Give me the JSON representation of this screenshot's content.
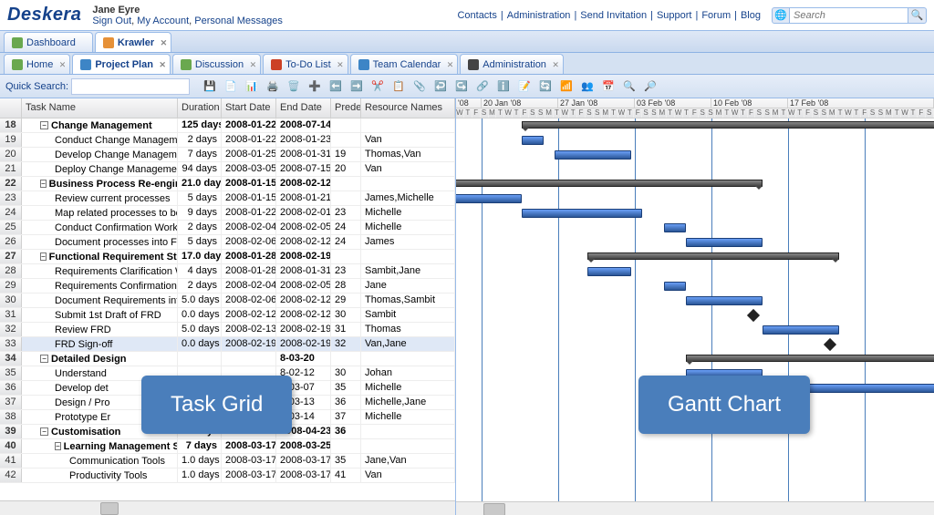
{
  "brand": "Deskera",
  "user": {
    "name": "Jane Eyre",
    "links": [
      "Sign Out",
      "My Account",
      "Personal Messages"
    ]
  },
  "header_links": [
    "Contacts",
    "Administration",
    "Send Invitation",
    "Support",
    "Forum",
    "Blog"
  ],
  "search": {
    "placeholder": "Search"
  },
  "main_tabs": [
    {
      "label": "Dashboard",
      "icon": "#6aa84f",
      "closable": false
    },
    {
      "label": "Krawler",
      "icon": "#e69138",
      "closable": true,
      "active": true
    }
  ],
  "sub_tabs": [
    {
      "label": "Home",
      "icon": "#6aa84f"
    },
    {
      "label": "Project Plan",
      "icon": "#3d85c6",
      "active": true
    },
    {
      "label": "Discussion",
      "icon": "#6aa84f"
    },
    {
      "label": "To-Do List",
      "icon": "#cc4125"
    },
    {
      "label": "Team Calendar",
      "icon": "#3d85c6"
    },
    {
      "label": "Administration",
      "icon": "#444"
    }
  ],
  "toolbar": {
    "quicksearch_label": "Quick Search:",
    "buttons": [
      "save",
      "export",
      "export2",
      "print",
      "delete",
      "add-task",
      "outdent",
      "indent",
      "cut",
      "copy",
      "paste",
      "undo",
      "redo",
      "link",
      "info",
      "note",
      "refresh",
      "sort-asc",
      "sort-desc",
      "today",
      "zoom-in",
      "zoom-out"
    ]
  },
  "grid_headers": {
    "name": "Task Name",
    "dur": "Duration",
    "sd": "Start Date",
    "ed": "End Date",
    "pred": "Predecessor",
    "res": "Resource Names"
  },
  "rows": [
    {
      "n": 18,
      "group": true,
      "ind": 1,
      "name": "Change Management",
      "dur": "125 days",
      "sd": "2008-01-22",
      "ed": "2008-07-14",
      "pred": "",
      "res": ""
    },
    {
      "n": 19,
      "group": false,
      "ind": 2,
      "name": "Conduct Change Management Pl",
      "dur": "2 days",
      "sd": "2008-01-22",
      "ed": "2008-01-23",
      "pred": "",
      "res": "Van"
    },
    {
      "n": 20,
      "group": false,
      "ind": 2,
      "name": "Develop Change Management Pl",
      "dur": "7 days",
      "sd": "2008-01-25",
      "ed": "2008-01-31",
      "pred": "19",
      "res": "Thomas,Van"
    },
    {
      "n": 21,
      "group": false,
      "ind": 2,
      "name": "Deploy Change Management Act",
      "dur": "94 days",
      "sd": "2008-03-05",
      "ed": "2008-07-15",
      "pred": "20",
      "res": "Van"
    },
    {
      "n": 22,
      "group": true,
      "ind": 1,
      "name": "Business Process Re-engineering",
      "dur": "21.0 days",
      "sd": "2008-01-15",
      "ed": "2008-02-12",
      "pred": "",
      "res": ""
    },
    {
      "n": 23,
      "group": false,
      "ind": 2,
      "name": "Review current processes",
      "dur": "5 days",
      "sd": "2008-01-15",
      "ed": "2008-01-21",
      "pred": "",
      "res": "James,Michelle"
    },
    {
      "n": 24,
      "group": false,
      "ind": 2,
      "name": "Map related processes to best p",
      "dur": "9 days",
      "sd": "2008-01-22",
      "ed": "2008-02-01",
      "pred": "23",
      "res": "Michelle"
    },
    {
      "n": 25,
      "group": false,
      "ind": 2,
      "name": "Conduct Confirmation Workshop",
      "dur": "2 days",
      "sd": "2008-02-04",
      "ed": "2008-02-05",
      "pred": "24",
      "res": "Michelle"
    },
    {
      "n": 26,
      "group": false,
      "ind": 2,
      "name": "Document processes into Functi",
      "dur": "5 days",
      "sd": "2008-02-06",
      "ed": "2008-02-12",
      "pred": "24",
      "res": "James"
    },
    {
      "n": 27,
      "group": true,
      "ind": 1,
      "name": "Functional Requirement Study",
      "dur": "17.0 days",
      "sd": "2008-01-28",
      "ed": "2008-02-19",
      "pred": "",
      "res": ""
    },
    {
      "n": 28,
      "group": false,
      "ind": 2,
      "name": "Requirements Clarification Works",
      "dur": "4 days",
      "sd": "2008-01-28",
      "ed": "2008-01-31",
      "pred": "23",
      "res": "Sambit,Jane"
    },
    {
      "n": 29,
      "group": false,
      "ind": 2,
      "name": "Requirements Confirmation work",
      "dur": "2 days",
      "sd": "2008-02-04",
      "ed": "2008-02-05",
      "pred": "28",
      "res": "Jane"
    },
    {
      "n": 30,
      "group": false,
      "ind": 2,
      "name": "Document Requirements into FRD",
      "dur": "5.0 days",
      "sd": "2008-02-06",
      "ed": "2008-02-12",
      "pred": "29",
      "res": "Thomas,Sambit"
    },
    {
      "n": 31,
      "group": false,
      "ind": 2,
      "name": "Submit 1st Draft of FRD",
      "dur": "0.0 days",
      "sd": "2008-02-12",
      "ed": "2008-02-12",
      "pred": "30",
      "res": "Sambit"
    },
    {
      "n": 32,
      "group": false,
      "ind": 2,
      "name": "Review FRD",
      "dur": "5.0 days",
      "sd": "2008-02-13",
      "ed": "2008-02-19",
      "pred": "31",
      "res": "Thomas"
    },
    {
      "n": 33,
      "group": false,
      "ind": 2,
      "name": "FRD Sign-off",
      "dur": "0.0 days",
      "sd": "2008-02-19",
      "ed": "2008-02-19",
      "pred": "32",
      "res": "Van,Jane",
      "sel": true
    },
    {
      "n": 34,
      "group": true,
      "ind": 1,
      "name": "Detailed Design",
      "dur": "",
      "sd": "",
      "ed": "8-03-20",
      "pred": "",
      "res": ""
    },
    {
      "n": 35,
      "group": false,
      "ind": 2,
      "name": "Understand",
      "dur": "",
      "sd": "",
      "ed": "8-02-12",
      "pred": "30",
      "res": "Johan"
    },
    {
      "n": 36,
      "group": false,
      "ind": 2,
      "name": "Develop det",
      "dur": "",
      "sd": "",
      "ed": "8-03-07",
      "pred": "35",
      "res": "Michelle"
    },
    {
      "n": 37,
      "group": false,
      "ind": 2,
      "name": "Design / Pro",
      "dur": "",
      "sd": "",
      "ed": "8-03-13",
      "pred": "36",
      "res": "Michelle,Jane"
    },
    {
      "n": 38,
      "group": false,
      "ind": 2,
      "name": "Prototype Er",
      "dur": "",
      "sd": "",
      "ed": "8-03-14",
      "pred": "37",
      "res": "Michelle"
    },
    {
      "n": 39,
      "group": true,
      "ind": 1,
      "name": "Customisation",
      "dur": "28 days",
      "sd": "2008-03-17",
      "ed": "2008-04-23",
      "pred": "36",
      "res": ""
    },
    {
      "n": 40,
      "group": true,
      "ind": 2,
      "name": "Learning Management System",
      "dur": "7 days",
      "sd": "2008-03-17",
      "ed": "2008-03-25",
      "pred": "",
      "res": ""
    },
    {
      "n": 41,
      "group": false,
      "ind": 3,
      "name": "Communication Tools",
      "dur": "1.0 days",
      "sd": "2008-03-17",
      "ed": "2008-03-17",
      "pred": "35",
      "res": "Jane,Van"
    },
    {
      "n": 42,
      "group": false,
      "ind": 3,
      "name": "Productivity Tools",
      "dur": "1.0 days",
      "sd": "2008-03-17",
      "ed": "2008-03-17",
      "pred": "41",
      "res": "Van"
    }
  ],
  "timeline": {
    "weeks": [
      "'08",
      "20 Jan '08",
      "27 Jan '08",
      "03 Feb '08",
      "10 Feb '08",
      "17 Feb '08"
    ],
    "day_letters": [
      "S",
      "M",
      "T",
      "W",
      "T",
      "F",
      "S"
    ]
  },
  "callouts": {
    "left": "Task Grid",
    "right": "Gantt Chart"
  }
}
